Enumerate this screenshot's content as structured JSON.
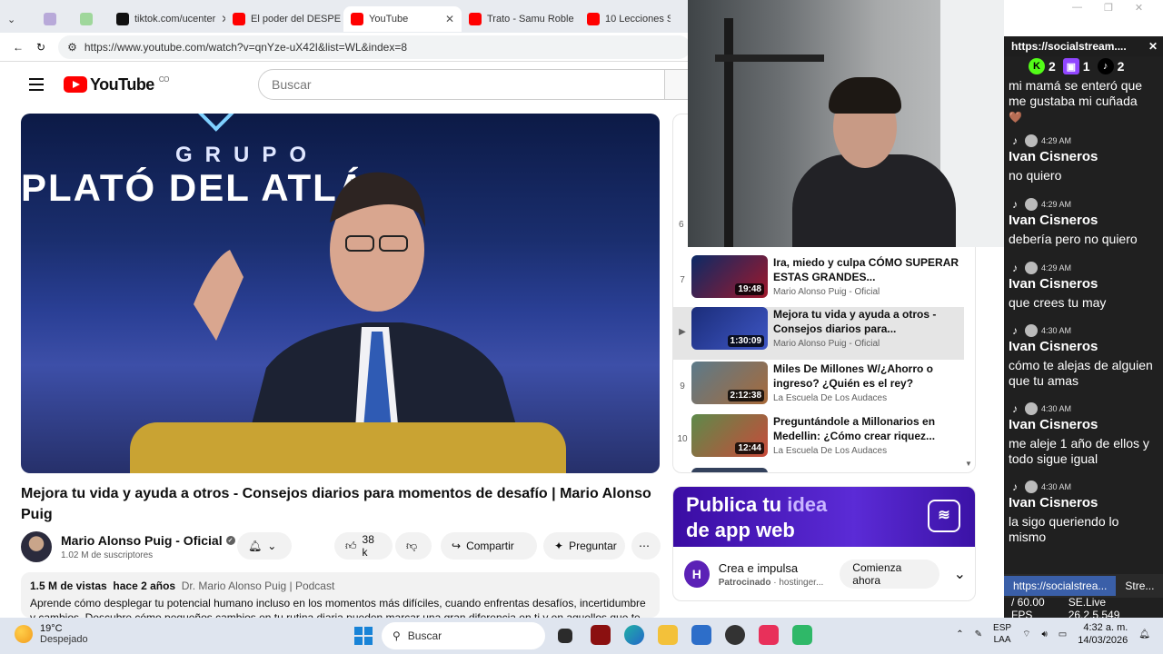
{
  "browser": {
    "tabs": [
      {
        "label": "",
        "fav_color": "#b8a9d9"
      },
      {
        "label": "",
        "fav_color": "#9fd79b"
      },
      {
        "label": "tiktok.com/ucenter",
        "fav_color": "#111111"
      },
      {
        "label": "El poder del DESPE",
        "fav_color": "#ff0000"
      },
      {
        "label": "YouTube",
        "fav_color": "#ff0000"
      },
      {
        "label": "Trato - Samu Roble",
        "fav_color": "#ff0000"
      },
      {
        "label": "10 Lecciones So",
        "fav_color": "#ff0000"
      }
    ],
    "url": "https://www.youtube.com/watch?v=qnYze-uX42I&list=WL&index=8"
  },
  "youtube": {
    "logo_text": "YouTube",
    "region": "CO",
    "search_placeholder": "Buscar"
  },
  "video": {
    "overlay_line1": "GRUPO",
    "overlay_line2": "PLATÓ DEL ATLÁ",
    "title": "Mejora tu vida y ayuda a otros - Consejos diarios para momentos de desafío | Mario Alonso Puig",
    "channel": "Mario Alonso Puig - Oficial",
    "subscribers": "1.02 M de suscriptores",
    "likes": "38 k",
    "share_label": "Compartir",
    "ask_label": "Preguntar",
    "views": "1.5 M de vistas",
    "age": "hace 2 años",
    "tags": "Dr. Mario Alonso Puig | Podcast",
    "description": "Aprende cómo desplegar tu potencial humano incluso en los momentos más difíciles, cuando enfrentas desafíos, incertidumbre y cambios. Descubre cómo pequeños cambios en tu rutina diaria pueden marcar una gran diferencia en ti y en aquellos que te"
  },
  "playlist": {
    "partial_index": "6",
    "items": [
      {
        "index": "7",
        "title": "Ira, miedo y culpa CÓMO SUPERAR ESTAS GRANDES...",
        "channel": "Mario Alonso Puig - Oficial",
        "duration": "19:48",
        "current": false
      },
      {
        "index": "▶",
        "title": "Mejora tu vida y ayuda a otros - Consejos diarios para...",
        "channel": "Mario Alonso Puig - Oficial",
        "duration": "1:30:09",
        "current": true
      },
      {
        "index": "9",
        "title": "Miles De Millones W/¿Ahorro o ingreso? ¿Quién es el rey?",
        "channel": "La Escuela De Los Audaces",
        "duration": "2:12:38",
        "current": false
      },
      {
        "index": "10",
        "title": "Preguntándole a Millonarios en Medellin: ¿Cómo crear riquez...",
        "channel": "La Escuela De Los Audaces",
        "duration": "12:44",
        "current": false
      }
    ]
  },
  "ad": {
    "headline_a": "Publica tu ",
    "headline_b": "idea",
    "headline_c": "de app web",
    "name": "Crea e impulsa",
    "sponsored": "Patrocinado",
    "advertiser": "hostinger...",
    "cta": "Comienza ahora"
  },
  "chat": {
    "window_title": "https://socialstream....",
    "counts": [
      {
        "platform": "kick",
        "value": "2"
      },
      {
        "platform": "twitch",
        "value": "1"
      },
      {
        "platform": "tiktok",
        "value": "2"
      }
    ],
    "top_partial": "mi mamá se enteró que me gustaba mi cuñada",
    "messages": [
      {
        "time": "4:29 AM",
        "name": "Ivan Cisneros",
        "text": "no quiero"
      },
      {
        "time": "4:29 AM",
        "name": "Ivan Cisneros",
        "text": "debería pero no quiero"
      },
      {
        "time": "4:29 AM",
        "name": "Ivan Cisneros",
        "text": "que crees tu may"
      },
      {
        "time": "4:30 AM",
        "name": "Ivan Cisneros",
        "text": "cómo te alejas de alguien que tu amas"
      },
      {
        "time": "4:30 AM",
        "name": "Ivan Cisneros",
        "text": "me aleje 1 año de ellos y todo sigue igual"
      },
      {
        "time": "4:30 AM",
        "name": "Ivan Cisneros",
        "text": "la sigo queriendo lo mismo"
      }
    ],
    "bottom_tab1": "https://socialstrea...",
    "bottom_tab2": "Stre...",
    "fps": "/ 60.00 FPS",
    "version": "SE.Live 26.2.5.549"
  },
  "taskbar": {
    "temperature": "19°C",
    "weather": "Despejado",
    "search_label": "Buscar",
    "lang1": "ESP",
    "lang2": "LAA",
    "time": "4:32 a. m.",
    "date": "14/03/2026"
  }
}
